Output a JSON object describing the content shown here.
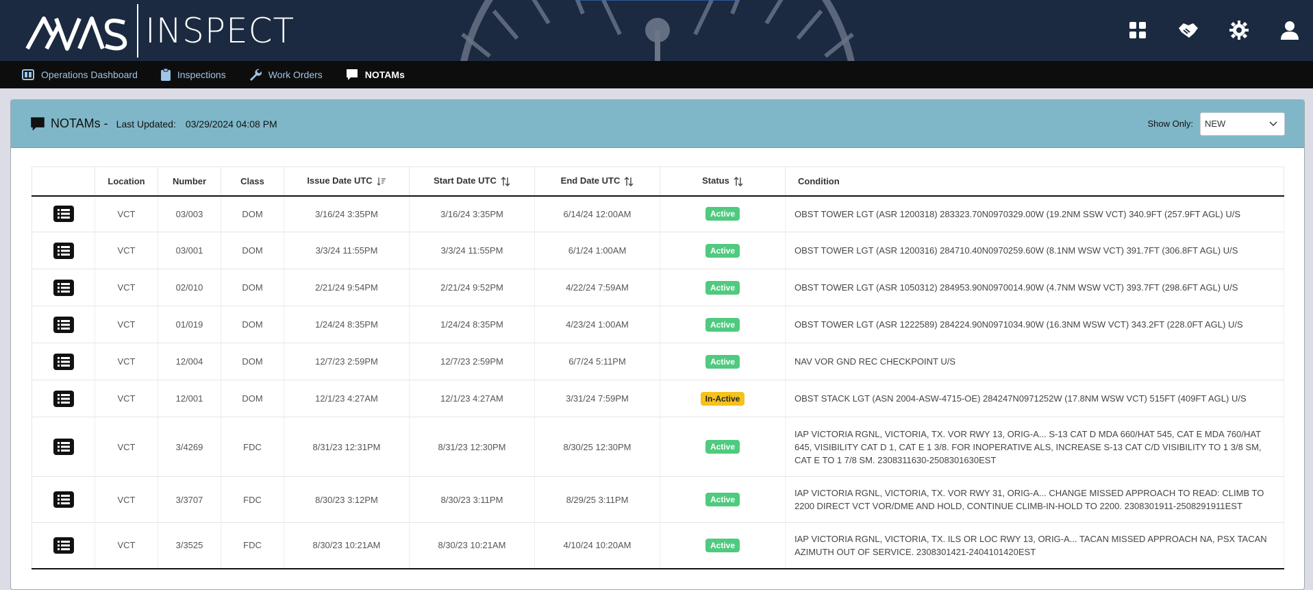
{
  "header": {
    "logo_mark": "AVIAS",
    "logo_text": "INSPECT",
    "icons": [
      "grid-icon",
      "handshake-icon",
      "gear-icon",
      "user-icon"
    ]
  },
  "nav": [
    {
      "label": "Operations Dashboard",
      "icon": "dashboard-icon",
      "active": false
    },
    {
      "label": "Inspections",
      "icon": "clipboard-icon",
      "active": false
    },
    {
      "label": "Work Orders",
      "icon": "wrench-icon",
      "active": false
    },
    {
      "label": "NOTAMs",
      "icon": "chat-icon",
      "active": true
    }
  ],
  "panel": {
    "title": "NOTAMs -",
    "last_updated_label": "Last Updated:",
    "last_updated_value": "03/29/2024 04:08 PM",
    "show_only_label": "Show Only:",
    "show_only_value": "NEW"
  },
  "table": {
    "columns": [
      "",
      "Location",
      "Number",
      "Class",
      "Issue Date UTC",
      "Start Date UTC",
      "End Date UTC",
      "Status",
      "Condition"
    ],
    "rows": [
      {
        "location": "VCT",
        "number": "03/003",
        "class": "DOM",
        "issue": "3/16/24 3:35PM",
        "start": "3/16/24 3:35PM",
        "end": "6/14/24 12:00AM",
        "status": "Active",
        "condition": "OBST TOWER LGT (ASR 1200318) 283323.70N0970329.00W (19.2NM SSW VCT) 340.9FT (257.9FT AGL) U/S"
      },
      {
        "location": "VCT",
        "number": "03/001",
        "class": "DOM",
        "issue": "3/3/24 11:55PM",
        "start": "3/3/24 11:55PM",
        "end": "6/1/24 1:00AM",
        "status": "Active",
        "condition": "OBST TOWER LGT (ASR 1200316) 284710.40N0970259.60W (8.1NM WSW VCT) 391.7FT (306.8FT AGL) U/S"
      },
      {
        "location": "VCT",
        "number": "02/010",
        "class": "DOM",
        "issue": "2/21/24 9:54PM",
        "start": "2/21/24 9:52PM",
        "end": "4/22/24 7:59AM",
        "status": "Active",
        "condition": "OBST TOWER LGT (ASR 1050312) 284953.90N0970014.90W (4.7NM WSW VCT) 393.7FT (298.6FT AGL) U/S"
      },
      {
        "location": "VCT",
        "number": "01/019",
        "class": "DOM",
        "issue": "1/24/24 8:35PM",
        "start": "1/24/24 8:35PM",
        "end": "4/23/24 1:00AM",
        "status": "Active",
        "condition": "OBST TOWER LGT (ASR 1222589) 284224.90N0971034.90W (16.3NM WSW VCT) 343.2FT (228.0FT AGL) U/S"
      },
      {
        "location": "VCT",
        "number": "12/004",
        "class": "DOM",
        "issue": "12/7/23 2:59PM",
        "start": "12/7/23 2:59PM",
        "end": "6/7/24 5:11PM",
        "status": "Active",
        "condition": "NAV VOR GND REC CHECKPOINT U/S"
      },
      {
        "location": "VCT",
        "number": "12/001",
        "class": "DOM",
        "issue": "12/1/23 4:27AM",
        "start": "12/1/23 4:27AM",
        "end": "3/31/24 7:59PM",
        "status": "In-Active",
        "condition": "OBST STACK LGT (ASN 2004-ASW-4715-OE) 284247N0971252W (17.8NM WSW VCT) 515FT (409FT AGL) U/S"
      },
      {
        "location": "VCT",
        "number": "3/4269",
        "class": "FDC",
        "issue": "8/31/23 12:31PM",
        "start": "8/31/23 12:30PM",
        "end": "8/30/25 12:30PM",
        "status": "Active",
        "condition": "IAP VICTORIA RGNL, VICTORIA, TX. VOR RWY 13, ORIG-A... S-13 CAT D MDA 660/HAT 545, CAT E MDA 760/HAT 645, VISIBILITY CAT D 1, CAT E 1 3/8. FOR INOPERATIVE ALS, INCREASE S-13 CAT C/D VISIBILITY TO 1 3/8 SM, CAT E TO 1 7/8 SM. 2308311630-2508301630EST"
      },
      {
        "location": "VCT",
        "number": "3/3707",
        "class": "FDC",
        "issue": "8/30/23 3:12PM",
        "start": "8/30/23 3:11PM",
        "end": "8/29/25 3:11PM",
        "status": "Active",
        "condition": "IAP VICTORIA RGNL, VICTORIA, TX. VOR RWY 31, ORIG-A... CHANGE MISSED APPROACH TO READ: CLIMB TO 2200 DIRECT VCT VOR/DME AND HOLD, CONTINUE CLIMB-IN-HOLD TO 2200. 2308301911-2508291911EST"
      },
      {
        "location": "VCT",
        "number": "3/3525",
        "class": "FDC",
        "issue": "8/30/23 10:21AM",
        "start": "8/30/23 10:21AM",
        "end": "4/10/24 10:20AM",
        "status": "Active",
        "condition": "IAP VICTORIA RGNL, VICTORIA, TX. ILS OR LOC RWY 13, ORIG-A... TACAN MISSED APPROACH NA, PSX TACAN AZIMUTH OUT OF SERVICE. 2308301421-2404101420EST"
      }
    ]
  },
  "colors": {
    "header_bg": "#1b2a40",
    "nav_bg": "#0d0d0d",
    "panel_header_bg": "#7fb7c8",
    "active_badge": "#4fca7f",
    "inactive_badge": "#f4c21b"
  }
}
